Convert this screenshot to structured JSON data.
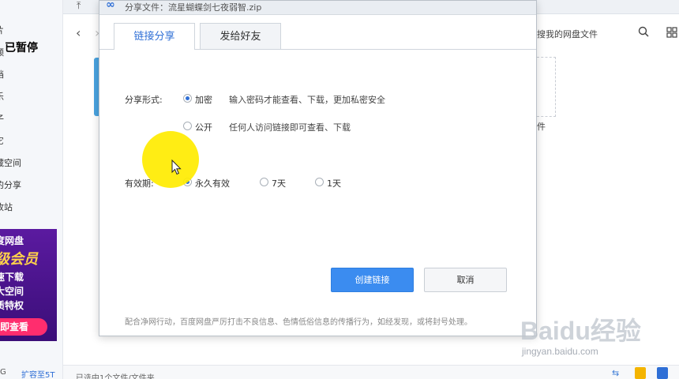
{
  "app": {
    "paused_label": "已暂停",
    "sidebar_items": [
      "片",
      "频",
      "档",
      "乐",
      "子",
      "它",
      "藏空间",
      "的分享",
      "收站"
    ],
    "storage_text": "G",
    "expand_link": "扩容至5T",
    "promo": {
      "line1": "度网盘",
      "line2": "级会员",
      "line3": "速下载",
      "line4": "大空间",
      "line5": "质特权",
      "button": "即查看"
    },
    "search_hint": "搜我的网盘文件",
    "file_suffix": "件",
    "status_text": "已选中1个文件/文件夹"
  },
  "dialog": {
    "title": "分享文件：流星蝴蝶剑七夜弱智.zip",
    "tabs": [
      {
        "label": "链接分享",
        "active": true
      },
      {
        "label": "发给好友",
        "active": false
      }
    ],
    "share_form_label": "分享形式:",
    "share_options": [
      {
        "label": "加密",
        "desc": "输入密码才能查看、下载，更加私密安全",
        "checked": true
      },
      {
        "label": "公开",
        "desc": "任何人访问链接即可查看、下载",
        "checked": false
      }
    ],
    "validity_label": "有效期:",
    "validity_options": [
      {
        "label": "永久有效",
        "checked": true
      },
      {
        "label": "7天",
        "checked": false
      },
      {
        "label": "1天",
        "checked": false
      }
    ],
    "create_button": "创建链接",
    "cancel_button": "取消",
    "footer_note": "配合净网行动，百度网盘严厉打击不良信息、色情低俗信息的传播行为，如经发现，或将封号处理。"
  },
  "watermark": {
    "brand": "Baidu经验",
    "url": "jingyan.baidu.com"
  },
  "colors": {
    "accent": "#3b8cf0",
    "promo_bg": "#4a148c",
    "promo_button": "#ff2d6e",
    "highlight": "#ffec00"
  }
}
